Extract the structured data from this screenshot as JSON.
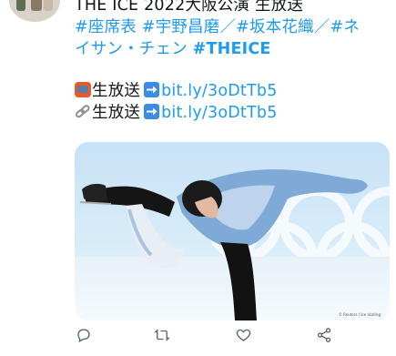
{
  "tweet": {
    "line1": "THE ICE 2022大阪公演 生放送",
    "line2_tags": [
      "#座席表",
      "#宇野昌磨",
      "／",
      "#坂本花織",
      "／",
      "#ネ"
    ],
    "line3_text": "イサン・チェン",
    "line3_tag": "#THEICE",
    "broadcast_label": "生放送",
    "link_label": "生放送",
    "url1": "bit.ly/3oDtTb5",
    "url2": "bit.ly/3oDtTb5"
  },
  "media": {
    "credit": "© Reuters / Ice skating"
  },
  "icons": {
    "tv": "tv-emoji-icon",
    "link": "link-emoji-icon",
    "arrow": "right-arrow-emoji-icon",
    "reply": "reply-icon",
    "retweet": "retweet-icon",
    "like": "heart-icon",
    "share": "share-icon"
  },
  "colors": {
    "hashtag": "#1d9bf0",
    "text": "#0f1419",
    "action": "#536471"
  }
}
